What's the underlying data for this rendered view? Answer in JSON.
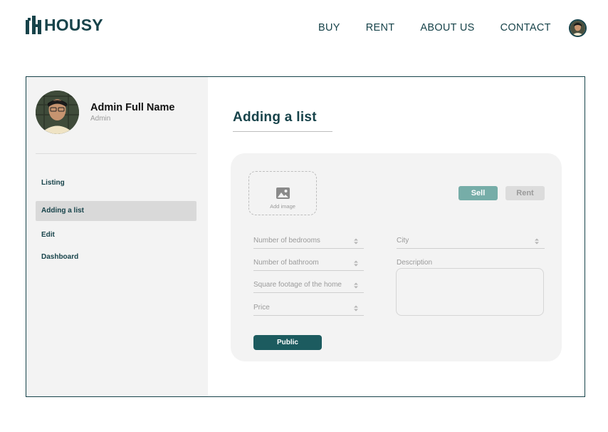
{
  "header": {
    "logo_text": "HOUSY",
    "nav": [
      "BUY",
      "RENT",
      "ABOUT US",
      "CONTACT"
    ]
  },
  "sidebar": {
    "profile": {
      "name": "Admin Full Name",
      "role": "Admin"
    },
    "items": [
      {
        "label": "Listing",
        "active": false
      },
      {
        "label": "Adding a list",
        "active": true
      },
      {
        "label": "Edit",
        "active": false
      },
      {
        "label": "Dashboard",
        "active": false
      }
    ]
  },
  "main": {
    "title": "Adding a list",
    "add_image_label": "Add image",
    "toggles": {
      "sell": "Sell",
      "rent": "Rent",
      "selected": "Sell"
    },
    "fields": {
      "bedrooms": "Number of bedrooms",
      "bathroom": "Number of bathroom",
      "square_footage": "Square footage of the home",
      "price": "Price",
      "city": "City",
      "description": "Description"
    },
    "public_button": "Public"
  },
  "colors": {
    "brand": "#17434a",
    "accent": "#76ada8",
    "button": "#1c5b5f",
    "panel": "#f3f3f3"
  }
}
